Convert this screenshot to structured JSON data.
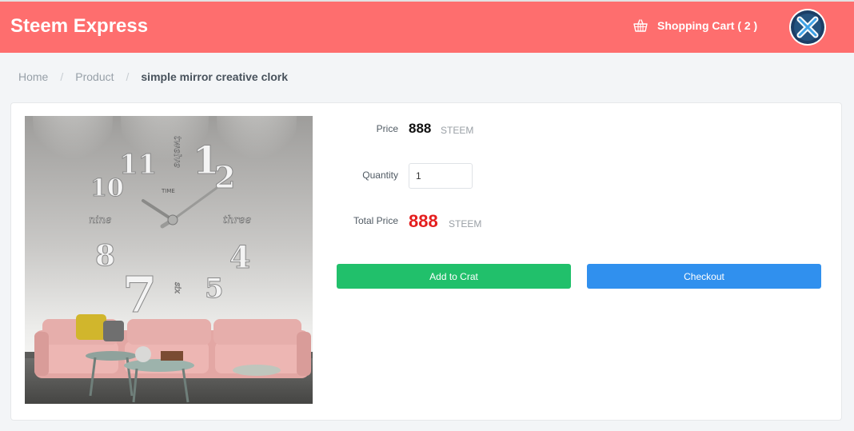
{
  "header": {
    "brand": "Steem Express",
    "cart_label": "Shopping Cart ( 2 )",
    "colors": {
      "header_bg": "#fe6e6e",
      "text": "#ffffff"
    }
  },
  "breadcrumb": {
    "home": "Home",
    "product": "Product",
    "current": "simple mirror creative clork",
    "separator": "/"
  },
  "product": {
    "image_icon": "wall-clock-living-room-photo",
    "price_label": "Price",
    "price_value": "888",
    "price_unit": "STEEM",
    "quantity_label": "Quantity",
    "quantity_value": "1",
    "total_label": "Total Price",
    "total_value": "888",
    "total_unit": "STEEM",
    "add_to_cart_label": "Add to Crat",
    "checkout_label": "Checkout",
    "colors": {
      "total": "#e41e1e",
      "add_button": "#21c06b",
      "checkout_button": "#3090ee"
    }
  },
  "icons": {
    "cart": "shopping-basket-icon",
    "avatar": "x-logo-avatar"
  }
}
